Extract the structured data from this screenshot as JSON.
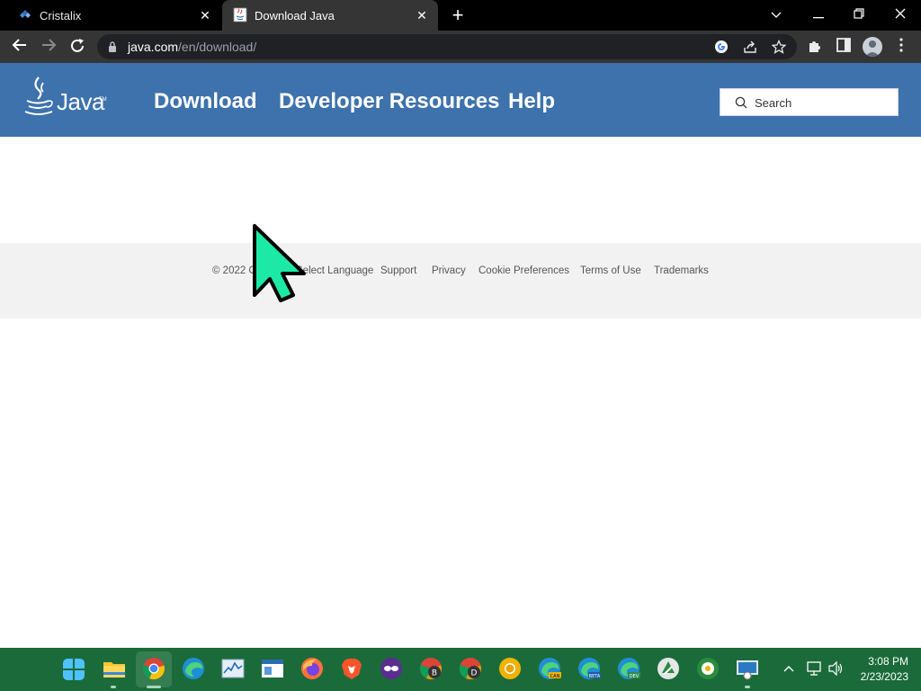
{
  "browser": {
    "tabs": [
      {
        "title": "Cristalix",
        "icon": "cristalix-favicon"
      },
      {
        "title": "Download Java",
        "icon": "java-favicon",
        "active": true
      }
    ],
    "url_host": "java.com",
    "url_path": "/en/download/"
  },
  "site": {
    "logo_text": "Java",
    "logo_tm": "TM",
    "nav": [
      "Download",
      "Developer Resources",
      "Help"
    ],
    "search_placeholder": "Search"
  },
  "footer": {
    "items": [
      "© 2022 Oracle",
      "Select Language",
      "Support",
      "Privacy",
      "Cookie Preferences",
      "Terms of Use",
      "Trademarks"
    ]
  },
  "taskbar": {
    "time": "3:08 PM",
    "date": "2/23/2023"
  },
  "colors": {
    "java_header": "#3d72ad",
    "taskbar": "#1b6b3a",
    "cursor": "#1de9a6"
  }
}
